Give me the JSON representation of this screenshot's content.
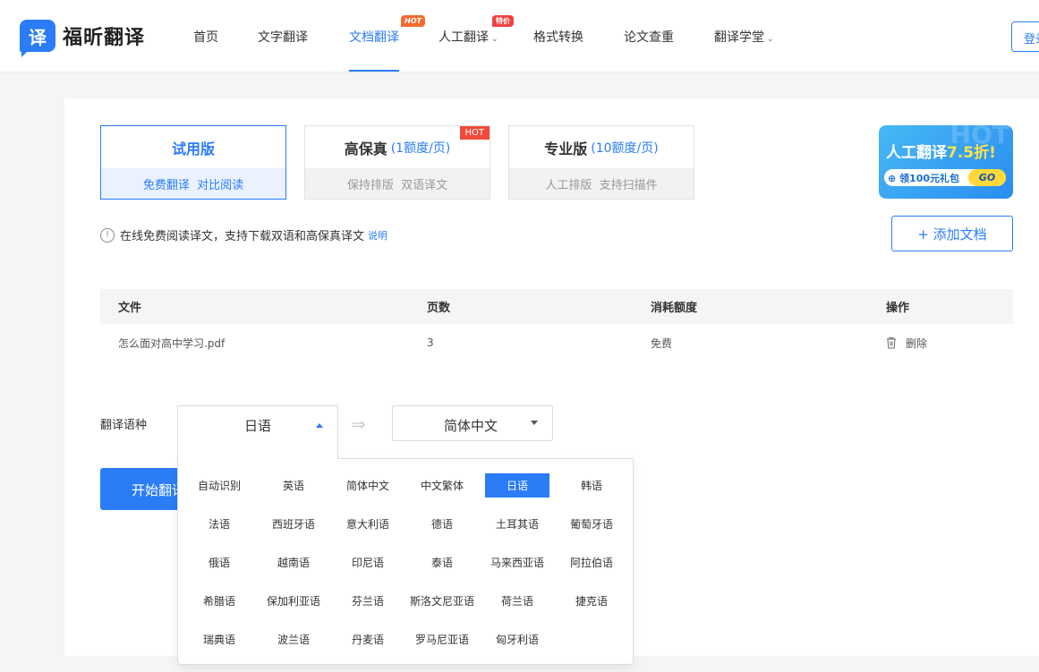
{
  "header": {
    "logo_icon": "译",
    "logo_text": "福昕翻译",
    "nav": [
      {
        "label": "首页"
      },
      {
        "label": "文字翻译"
      },
      {
        "label": "文档翻译",
        "badge": "HOT"
      },
      {
        "label": "人工翻译",
        "badge": "特价"
      },
      {
        "label": "格式转换"
      },
      {
        "label": "论文查重"
      },
      {
        "label": "翻译学堂"
      }
    ],
    "login": "登录"
  },
  "plans": [
    {
      "title": "试用版",
      "price": "",
      "sub": "免费翻译  对比阅读"
    },
    {
      "title": "高保真",
      "price": "(1额度/页)",
      "sub": "保持排版  双语译文",
      "badge": "HOT"
    },
    {
      "title": "专业版",
      "price": "(10额度/页)",
      "sub": "人工排版  支持扫描件"
    }
  ],
  "promo": {
    "title": "人工翻译",
    "discount": "7.5折!",
    "pill": "领100元礼包",
    "go": "GO",
    "ghost": "HOT"
  },
  "notice": {
    "text": "在线免费阅读译文，支持下载双语和高保真译文",
    "link": "说明"
  },
  "add_doc": "+ 添加文档",
  "table": {
    "headers": [
      "文件",
      "页数",
      "消耗额度",
      "操作"
    ],
    "rows": [
      {
        "file": "怎么面对高中学习.pdf",
        "pages": "3",
        "cost": "免费",
        "action": "删除"
      }
    ]
  },
  "lang": {
    "label": "翻译语种",
    "source": "日语",
    "target": "简体中文",
    "options": [
      "自动识别",
      "英语",
      "简体中文",
      "中文繁体",
      "日语",
      "韩语",
      "法语",
      "西班牙语",
      "意大利语",
      "德语",
      "土耳其语",
      "葡萄牙语",
      "俄语",
      "越南语",
      "印尼语",
      "泰语",
      "马来西亚语",
      "阿拉伯语",
      "希腊语",
      "保加利亚语",
      "芬兰语",
      "斯洛文尼亚语",
      "荷兰语",
      "捷克语",
      "瑞典语",
      "波兰语",
      "丹麦语",
      "罗马尼亚语",
      "匈牙利语"
    ],
    "selected": "日语"
  },
  "start_btn": "开始翻译",
  "colors": {
    "accent": "#2a7cf7",
    "hot": "#f04b3a"
  }
}
